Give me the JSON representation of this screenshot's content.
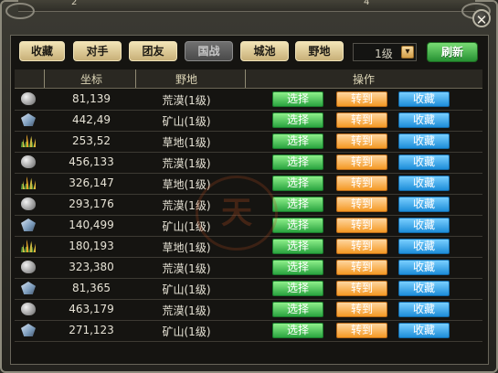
{
  "window": {
    "top_numbers": [
      "2",
      "4"
    ],
    "close_symbol": "✕"
  },
  "tabs": [
    {
      "label": "收藏",
      "active": false
    },
    {
      "label": "对手",
      "active": false
    },
    {
      "label": "团友",
      "active": false
    },
    {
      "label": "国战",
      "active": true
    },
    {
      "label": "城池",
      "active": false
    },
    {
      "label": "野地",
      "active": false
    }
  ],
  "filter": {
    "level": "1级",
    "dropdown_icon": "chevron-down-icon"
  },
  "refresh_label": "刷新",
  "table": {
    "headers": [
      "坐标",
      "野地",
      "操作"
    ],
    "rows": [
      {
        "icon": "stone-icon",
        "coord": "81,139",
        "land": "荒漠(1级)"
      },
      {
        "icon": "ore-icon",
        "coord": "442,49",
        "land": "矿山(1级)"
      },
      {
        "icon": "grass-icon",
        "coord": "253,52",
        "land": "草地(1级)"
      },
      {
        "icon": "stone-icon",
        "coord": "456,133",
        "land": "荒漠(1级)"
      },
      {
        "icon": "grass-icon",
        "coord": "326,147",
        "land": "草地(1级)"
      },
      {
        "icon": "stone-icon",
        "coord": "293,176",
        "land": "荒漠(1级)"
      },
      {
        "icon": "ore-icon",
        "coord": "140,499",
        "land": "矿山(1级)"
      },
      {
        "icon": "grass-icon",
        "coord": "180,193",
        "land": "草地(1级)"
      },
      {
        "icon": "stone-icon",
        "coord": "323,380",
        "land": "荒漠(1级)"
      },
      {
        "icon": "ore-icon",
        "coord": "81,365",
        "land": "矿山(1级)"
      },
      {
        "icon": "stone-icon",
        "coord": "463,179",
        "land": "荒漠(1级)"
      },
      {
        "icon": "ore-icon",
        "coord": "271,123",
        "land": "矿山(1级)"
      }
    ],
    "actions": {
      "select": "选择",
      "goto": "转到",
      "favorite": "收藏"
    }
  },
  "colors": {
    "select_button": "#2aa540",
    "goto_button": "#f49924",
    "favorite_button": "#1e8ed9",
    "refresh_button": "#269132"
  }
}
